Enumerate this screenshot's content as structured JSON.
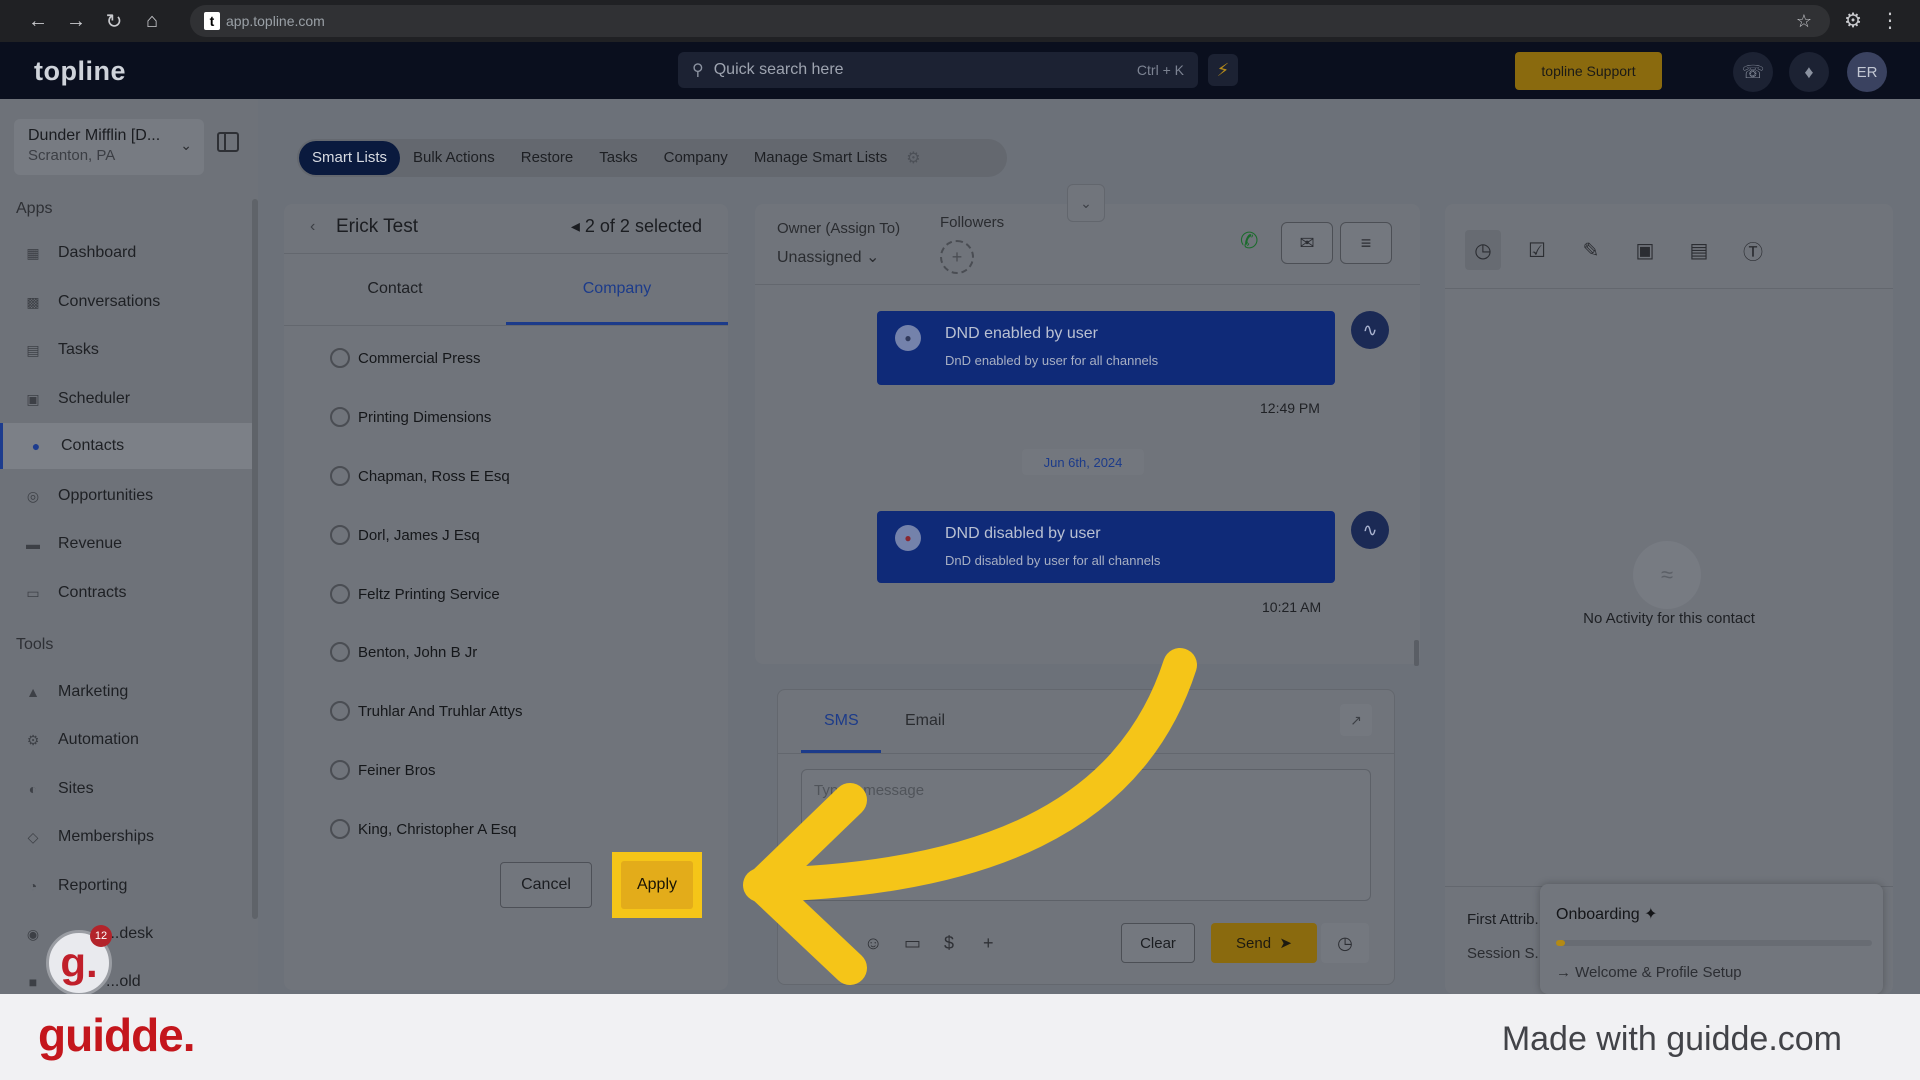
{
  "browser": {
    "url": "app.topline.com",
    "favicon_letter": "t"
  },
  "header": {
    "logo": "topline",
    "search_placeholder": "Quick search here",
    "search_shortcut": "Ctrl + K",
    "support_label": "topline Support",
    "avatar_initials": "ER"
  },
  "sidebar": {
    "account_name": "Dunder Mifflin [D...",
    "account_location": "Scranton, PA",
    "apps_label": "Apps",
    "tools_label": "Tools",
    "apps": [
      {
        "label": "Dashboard",
        "icon": "dashboard-icon"
      },
      {
        "label": "Conversations",
        "icon": "chat-icon"
      },
      {
        "label": "Tasks",
        "icon": "tasks-icon"
      },
      {
        "label": "Scheduler",
        "icon": "calendar-icon"
      },
      {
        "label": "Contacts",
        "icon": "person-icon",
        "active": true
      },
      {
        "label": "Opportunities",
        "icon": "target-icon"
      },
      {
        "label": "Revenue",
        "icon": "card-icon"
      },
      {
        "label": "Contracts",
        "icon": "document-icon"
      }
    ],
    "tools": [
      {
        "label": "Marketing",
        "icon": "megaphone-icon"
      },
      {
        "label": "Automation",
        "icon": "gears-icon"
      },
      {
        "label": "Sites",
        "icon": "globe-icon"
      },
      {
        "label": "Memberships",
        "icon": "members-icon"
      },
      {
        "label": "Reporting",
        "icon": "pie-icon"
      },
      {
        "label": "...desk",
        "icon": "help-icon"
      },
      {
        "label": "...old",
        "icon": "box-icon"
      }
    ],
    "guidde_badge_count": "12"
  },
  "tabbar": {
    "tabs": [
      "Smart Lists",
      "Bulk Actions",
      "Restore",
      "Tasks",
      "Company",
      "Manage Smart Lists"
    ]
  },
  "contact_panel": {
    "name": "Erick Test",
    "selection": "2 of 2 selected",
    "tabs": [
      "Contact",
      "Company"
    ],
    "active_tab": "Company",
    "companies": [
      "Commercial Press",
      "Printing Dimensions",
      "Chapman, Ross E Esq",
      "Dorl, James J Esq",
      "Feltz Printing Service",
      "Benton, John B Jr",
      "Truhlar And Truhlar Attys",
      "Feiner Bros",
      "King, Christopher A Esq"
    ],
    "cancel_label": "Cancel",
    "apply_label": "Apply"
  },
  "conversation": {
    "owner_label": "Owner (Assign To)",
    "owner_value": "Unassigned",
    "followers_label": "Followers",
    "events": [
      {
        "title": "DND enabled by user",
        "subtitle": "DnD enabled by user for all channels",
        "time": "12:49 PM"
      },
      {
        "title": "DND disabled by user",
        "subtitle": "DnD disabled by user for all channels",
        "time": "10:21 AM"
      }
    ],
    "date_divider": "Jun 6th, 2024",
    "composer": {
      "tabs": [
        "SMS",
        "Email"
      ],
      "active_tab": "SMS",
      "placeholder": "Type a message",
      "clear_label": "Clear",
      "send_label": "Send"
    }
  },
  "activity": {
    "empty_text": "No Activity for this contact",
    "first_attribution": "First Attrib...",
    "session": "Session S..."
  },
  "onboarding": {
    "title": "Onboarding",
    "step": "Welcome & Profile Setup",
    "progress": 0.03
  },
  "footer": {
    "brand": "guidde.",
    "made_with": "Made with guidde.com"
  },
  "colors": {
    "highlight": "#f5c518",
    "brand_red": "#c4161c",
    "accent_blue": "#1c3b8a"
  }
}
